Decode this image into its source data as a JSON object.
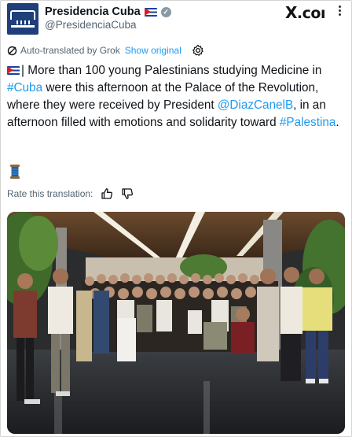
{
  "header": {
    "display_name": "Presidencia Cuba",
    "handle": "@PresidenciaCuba",
    "avatar_icon": "presidency-seal-icon",
    "verified_icon": "verified-badge-icon",
    "flag_icon": "cuba-flag-icon",
    "site_logo_x": "X",
    "site_logo_suffix": ".coı"
  },
  "translation": {
    "auto_label": "Auto-translated by Grok",
    "show_original": "Show original"
  },
  "tweet": {
    "text_1": "| More than 100 young Palestinians studying Medicine in ",
    "link_cuba": "#Cuba",
    "text_2": " were this afternoon at the Palace of the Revolution, where they were received by President ",
    "link_president": "@DiazCanelB",
    "text_3": ", in an afternoon filled with emotions and solidarity toward ",
    "link_palestina": "#Palestina",
    "text_4": ".",
    "emoji": "spool-of-thread-icon"
  },
  "rating": {
    "label": "Rate this translation:"
  },
  "colors": {
    "link": "#1d9bf0",
    "secondary_text": "#536471",
    "primary_text": "#0f1419",
    "avatar_bg": "#1f3f7a"
  },
  "photo": {
    "description_icon": "group-photo-image"
  }
}
